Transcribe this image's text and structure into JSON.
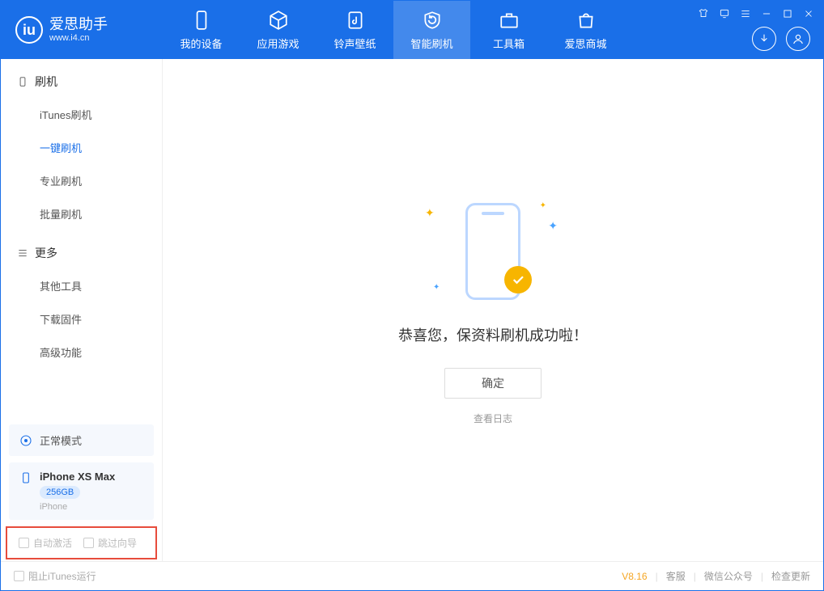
{
  "app": {
    "name": "爱思助手",
    "site": "www.i4.cn"
  },
  "tabs": {
    "device": "我的设备",
    "apps": "应用游戏",
    "ringtone": "铃声壁纸",
    "flash": "智能刷机",
    "toolbox": "工具箱",
    "store": "爱思商城"
  },
  "sidebar": {
    "flash": {
      "title": "刷机",
      "items": [
        "iTunes刷机",
        "一键刷机",
        "专业刷机",
        "批量刷机"
      ]
    },
    "more": {
      "title": "更多",
      "items": [
        "其他工具",
        "下载固件",
        "高级功能"
      ]
    }
  },
  "devices": {
    "mode": "正常模式",
    "model": "iPhone XS Max",
    "capacity": "256GB",
    "type": "iPhone"
  },
  "options": {
    "auto_activate": "自动激活",
    "skip_guide": "跳过向导"
  },
  "main": {
    "success": "恭喜您，保资料刷机成功啦！",
    "ok": "确定",
    "view_log": "查看日志"
  },
  "status": {
    "block_itunes": "阻止iTunes运行",
    "version": "V8.16",
    "support": "客服",
    "wechat": "微信公众号",
    "update": "检查更新"
  }
}
